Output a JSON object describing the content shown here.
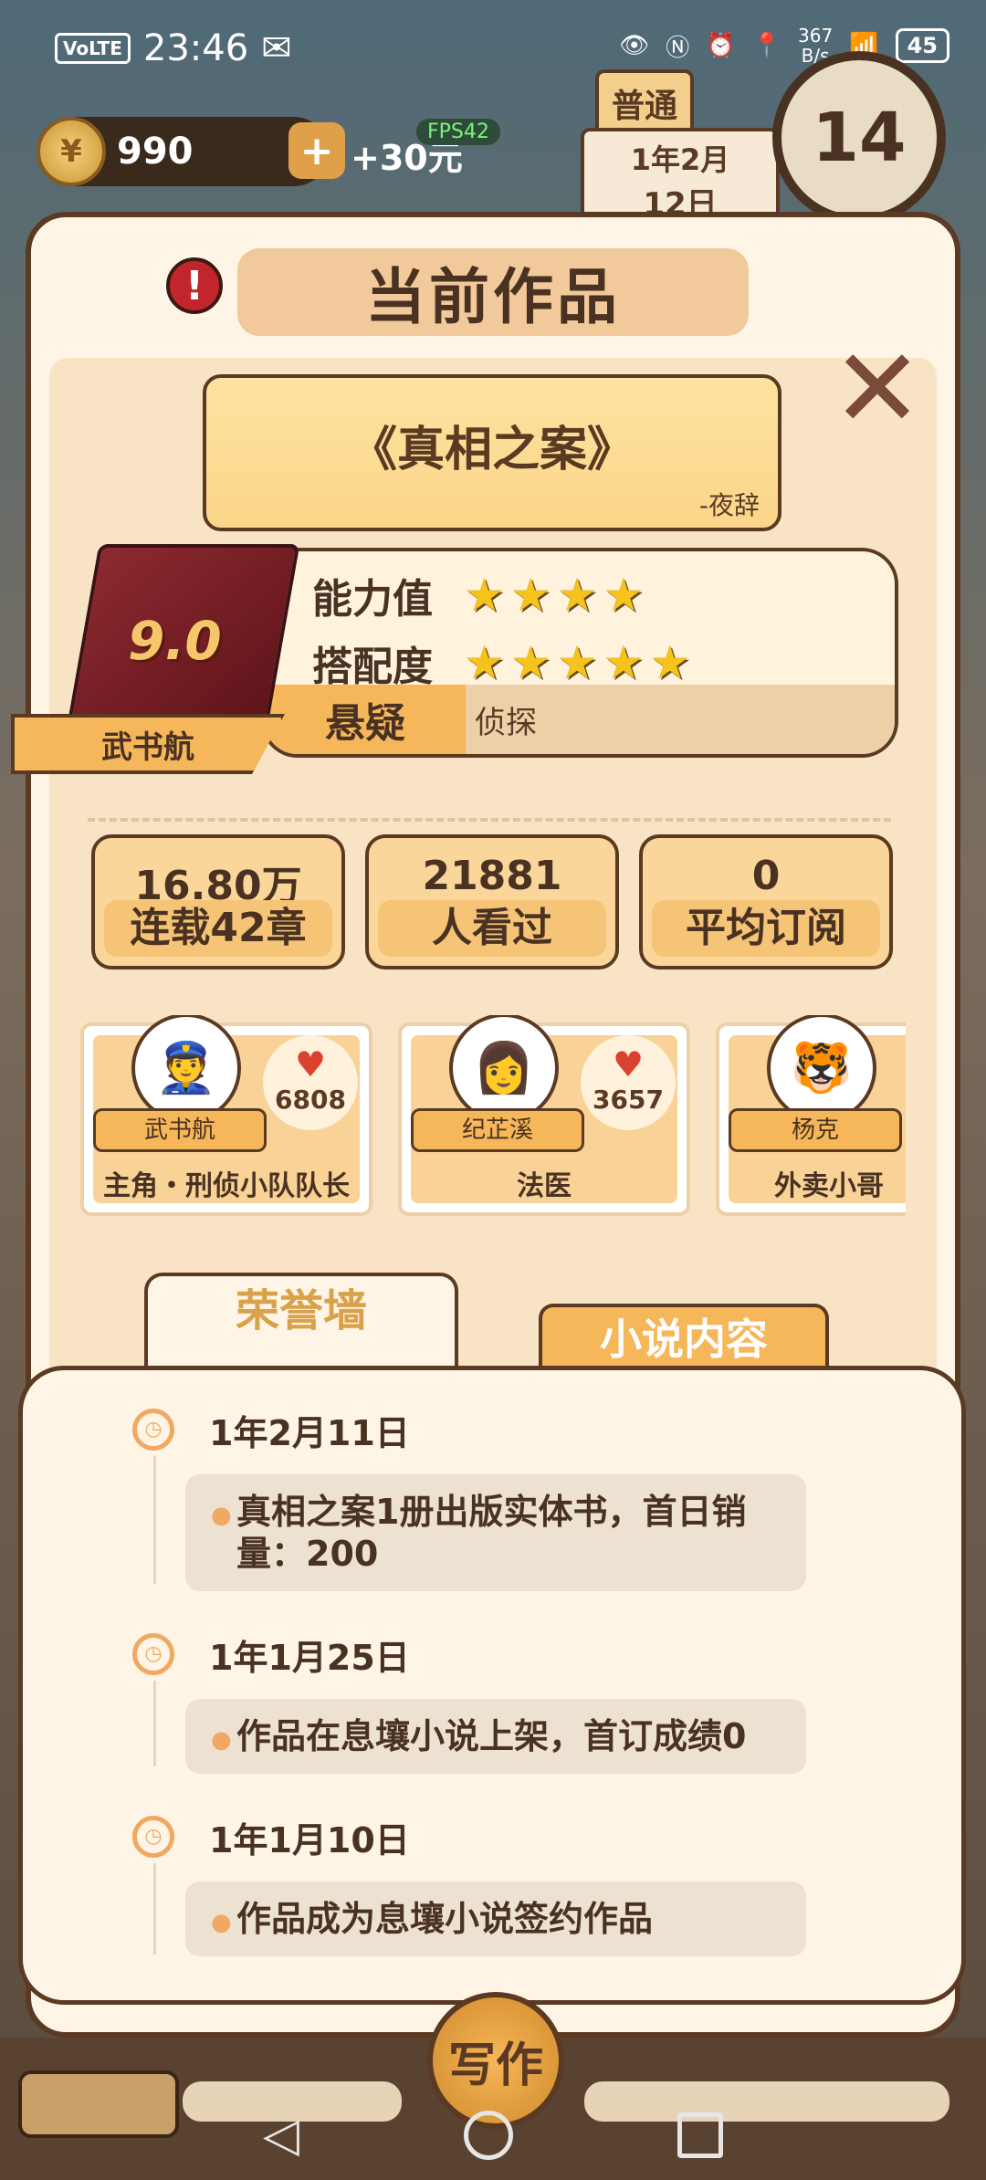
{
  "status_bar": {
    "volte": "VoLTE",
    "time": "23:46",
    "net_speed": "367\nB/s",
    "battery": "45"
  },
  "hud": {
    "coins": "990",
    "gain": "+30元",
    "fps": "FPS42",
    "mode": "普通",
    "date_line1": "1年2月",
    "date_line2": "12日",
    "day": "14"
  },
  "modal": {
    "title": "当前作品",
    "book": {
      "title": "《真相之案》",
      "author": "-夜辞",
      "score": "9.0",
      "writer": "武书航"
    },
    "ability_label": "能力值",
    "ability_stars": 4,
    "match_label": "搭配度",
    "match_stars": 5,
    "genre_main": "悬疑",
    "genre_sub": "侦探",
    "stats": [
      {
        "value": "16.80万",
        "label": "连载42章"
      },
      {
        "value": "21881",
        "label": "人看过"
      },
      {
        "value": "0",
        "label": "平均订阅"
      }
    ],
    "characters": [
      {
        "name": "武书航",
        "role": "主角・刑侦小队队长",
        "hearts": "6808",
        "avatar": "👮"
      },
      {
        "name": "纪芷溪",
        "role": "法医",
        "hearts": "3657",
        "avatar": "👩"
      },
      {
        "name": "杨克",
        "role": "外卖小哥",
        "hearts": "",
        "avatar": "🐯"
      }
    ],
    "tabs": {
      "honor": "荣誉墙",
      "content": "小说内容"
    },
    "timeline": [
      {
        "date": "1年2月11日",
        "text": "真相之案1册出版实体书，首日销量：200"
      },
      {
        "date": "1年1月25日",
        "text": "作品在息壤小说上架，首订成绩0"
      },
      {
        "date": "1年1月10日",
        "text": "作品成为息壤小说签约作品"
      }
    ]
  },
  "bottom": {
    "write": "写作"
  }
}
